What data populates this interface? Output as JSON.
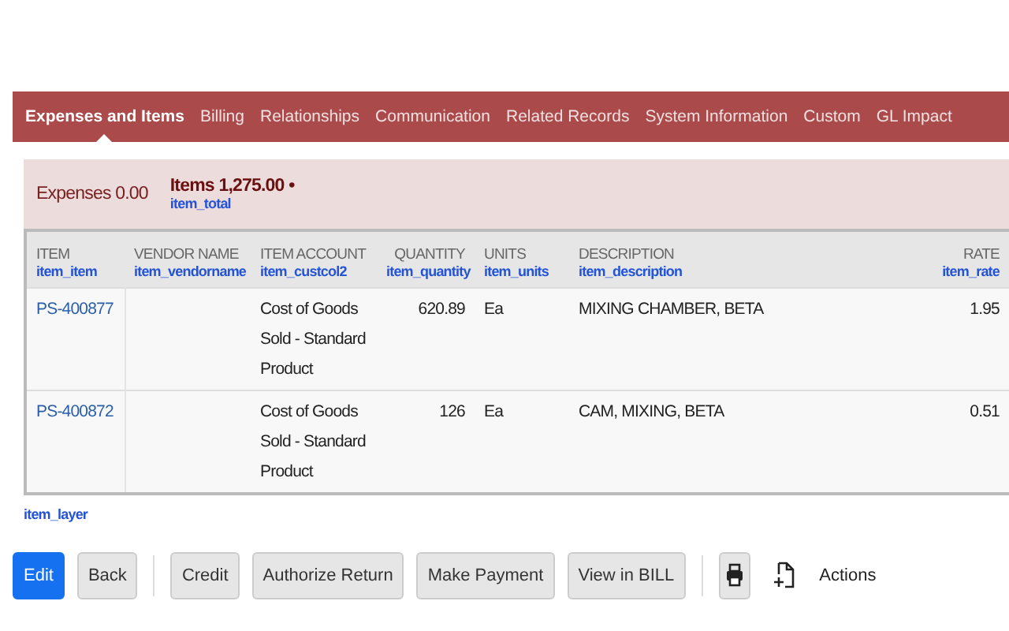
{
  "tabs": [
    {
      "label": "Expenses and Items",
      "selected": true
    },
    {
      "label": "Billing",
      "selected": false
    },
    {
      "label": "Relationships",
      "selected": false
    },
    {
      "label": "Communication",
      "selected": false
    },
    {
      "label": "Related Records",
      "selected": false
    },
    {
      "label": "System Information",
      "selected": false
    },
    {
      "label": "Custom",
      "selected": false
    },
    {
      "label": "GL Impact",
      "selected": false
    }
  ],
  "subtabs": [
    {
      "label": "Expenses 0.00",
      "selected": false
    },
    {
      "label": "Items 1,275.00 •",
      "field_id": "item_total",
      "selected": true
    }
  ],
  "table": {
    "columns": [
      {
        "label": "ITEM",
        "field_id": "item_item",
        "numeric": false
      },
      {
        "label": "VENDOR NAME",
        "field_id": "item_vendorname",
        "numeric": false
      },
      {
        "label": "ITEM ACCOUNT",
        "field_id": "item_custcol2",
        "numeric": false
      },
      {
        "label": "QUANTITY",
        "field_id": "item_quantity",
        "numeric": true
      },
      {
        "label": "UNITS",
        "field_id": "item_units",
        "numeric": false
      },
      {
        "label": "DESCRIPTION",
        "field_id": "item_description",
        "numeric": false
      },
      {
        "label": "RATE",
        "field_id": "item_rate",
        "numeric": true
      }
    ],
    "rows": [
      [
        "PS-400877",
        "",
        "Cost of Goods Sold - Standard Product",
        "620.89",
        "Ea",
        "MIXING CHAMBER, BETA",
        "1.95"
      ],
      [
        "PS-400872",
        "",
        "Cost of Goods Sold - Standard Product",
        "126",
        "Ea",
        "CAM, MIXING, BETA",
        "0.51"
      ]
    ]
  },
  "layer_id": "item_layer",
  "buttons": [
    {
      "label": "Edit",
      "kind": "primary"
    },
    {
      "label": "Back",
      "kind": "plain"
    },
    {
      "kind": "divider"
    },
    {
      "label": "Credit",
      "kind": "plain"
    },
    {
      "label": "Authorize Return",
      "kind": "plain"
    },
    {
      "label": "Make Payment",
      "kind": "plain"
    },
    {
      "label": "View in BILL",
      "kind": "plain"
    },
    {
      "kind": "divider"
    },
    {
      "kind": "print"
    },
    {
      "label": "Actions",
      "kind": "actions"
    }
  ]
}
